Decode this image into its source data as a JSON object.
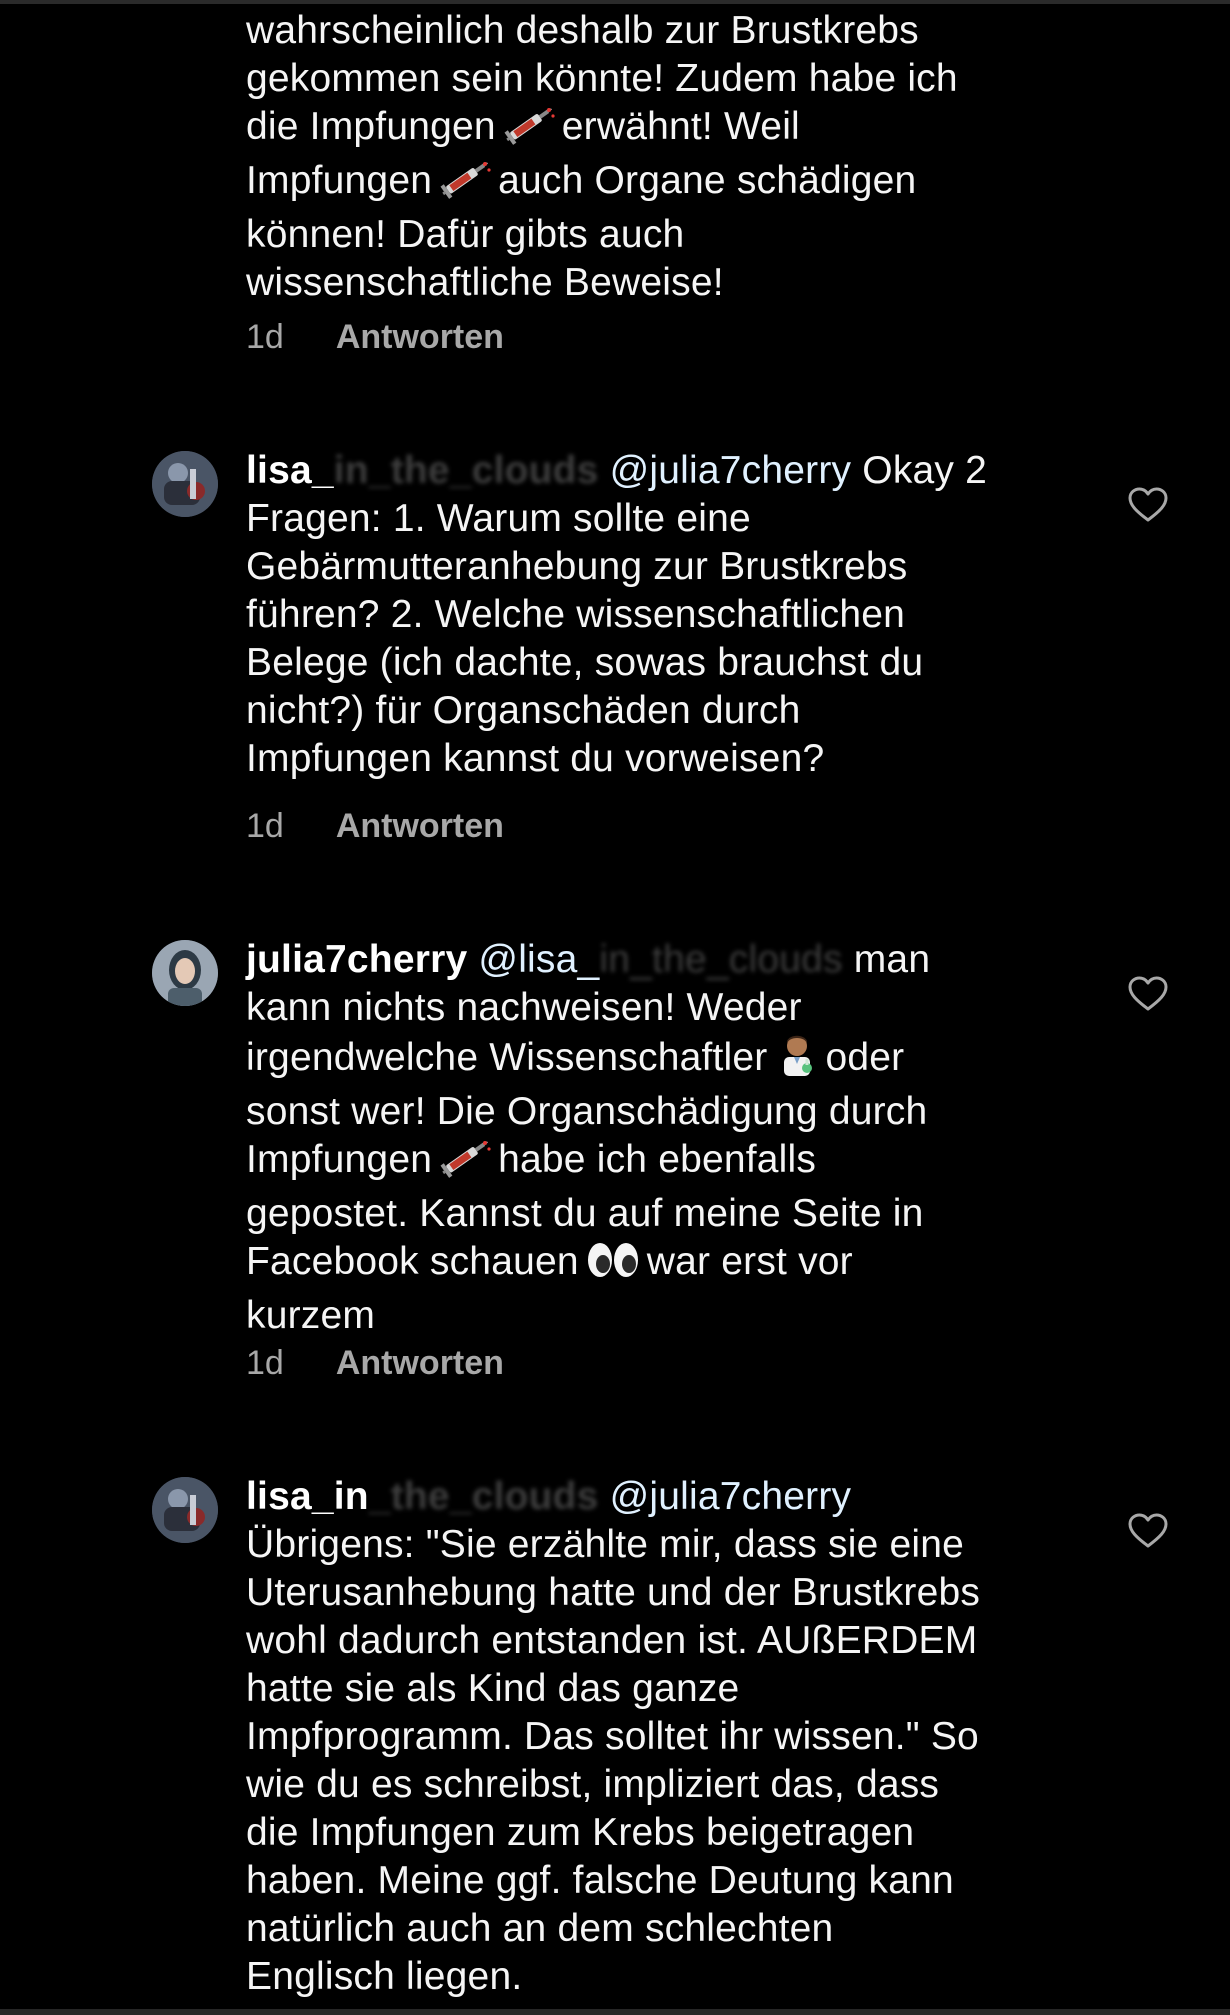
{
  "comments": [
    {
      "id": "c0",
      "continuation": true,
      "lines": [
        "wahrscheinlich deshalb zur Brustkrebs",
        "gekommen sein könnte! Zudem habe ich",
        "die Impfungen",
        "erwähnt! Weil",
        "Impfungen",
        "auch Organe schädigen",
        "können! Dafür gibts auch",
        "wissenschaftliche Beweise!"
      ],
      "time": "1d",
      "reply_label": "Antworten"
    },
    {
      "id": "c1",
      "username": "lisa_",
      "username_blurred": "in_the_clouds",
      "mention": "@julia7cherry",
      "text_first": "Okay 2",
      "lines": [
        "Fragen: 1. Warum sollte eine",
        "Gebärmutteranhebung zur Brustkrebs",
        "führen? 2. Welche wissenschaftlichen",
        "Belege (ich dachte, sowas brauchst du",
        "nicht?) für Organschäden durch",
        "Impfungen kannst du vorweisen?"
      ],
      "time": "1d",
      "reply_label": "Antworten"
    },
    {
      "id": "c2",
      "username": "julia7cherry",
      "mention": "@lisa_",
      "mention_blurred": "in_the_clouds",
      "text_first": "man",
      "lines": [
        "kann nichts nachweisen! Weder",
        "irgendwelche Wissenschaftler",
        "oder",
        "sonst wer! Die Organschädigung durch",
        "Impfungen",
        "habe ich ebenfalls",
        "gepostet. Kannst du auf meine Seite in",
        "Facebook schauen",
        "war erst vor",
        "kurzem"
      ],
      "time": "1d",
      "reply_label": "Antworten"
    },
    {
      "id": "c3",
      "username": "lisa_in",
      "username_blurred": "_the_clouds",
      "mention": "@julia7cherry",
      "lines": [
        "Übrigens: \"Sie erzählte mir, dass sie eine",
        "Uterusanhebung hatte und der Brustkrebs",
        "wohl dadurch entstanden ist. AUßERDEM",
        "hatte sie als Kind das ganze",
        "Impfprogramm. Das solltet ihr wissen.\" So",
        "wie du es schreibst, impliziert das, dass",
        "die Impfungen zum Krebs beigetragen",
        "haben. Meine ggf. falsche Deutung kann",
        "natürlich auch an dem schlechten",
        "Englisch liegen."
      ]
    }
  ],
  "icons": {
    "heart": "heart-outline-icon",
    "syringe": "syringe-emoji",
    "scientist": "scientist-emoji",
    "eyes": "eyes-emoji"
  },
  "colors": {
    "background": "#000000",
    "text": "#f5f5f5",
    "meta": "#a8a8a8"
  }
}
